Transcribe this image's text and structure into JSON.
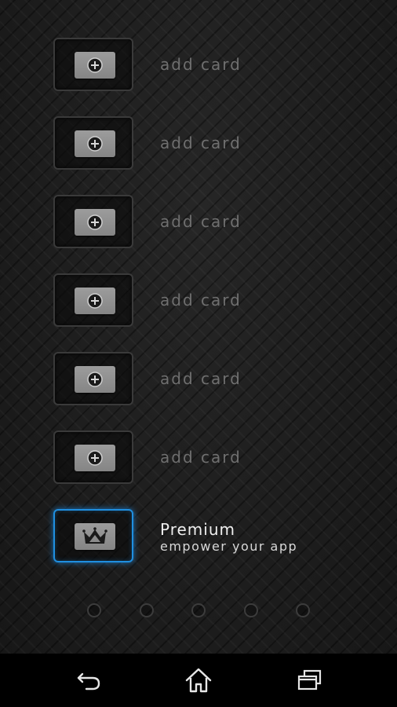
{
  "cards": [
    {
      "label": "add card",
      "icon": "card-plus-icon"
    },
    {
      "label": "add card",
      "icon": "card-plus-icon"
    },
    {
      "label": "add card",
      "icon": "card-plus-icon"
    },
    {
      "label": "add card",
      "icon": "card-plus-icon"
    },
    {
      "label": "add card",
      "icon": "card-plus-icon"
    },
    {
      "label": "add card",
      "icon": "card-plus-icon"
    }
  ],
  "premium": {
    "title": "Premium",
    "subtitle": "empower your app",
    "icon": "crown-icon",
    "accent": "#1f8fe0"
  },
  "pager": {
    "pages": 5,
    "current": 0
  },
  "navbar": {
    "back_icon": "back-icon",
    "home_icon": "home-icon",
    "recents_icon": "recent-apps-icon"
  }
}
